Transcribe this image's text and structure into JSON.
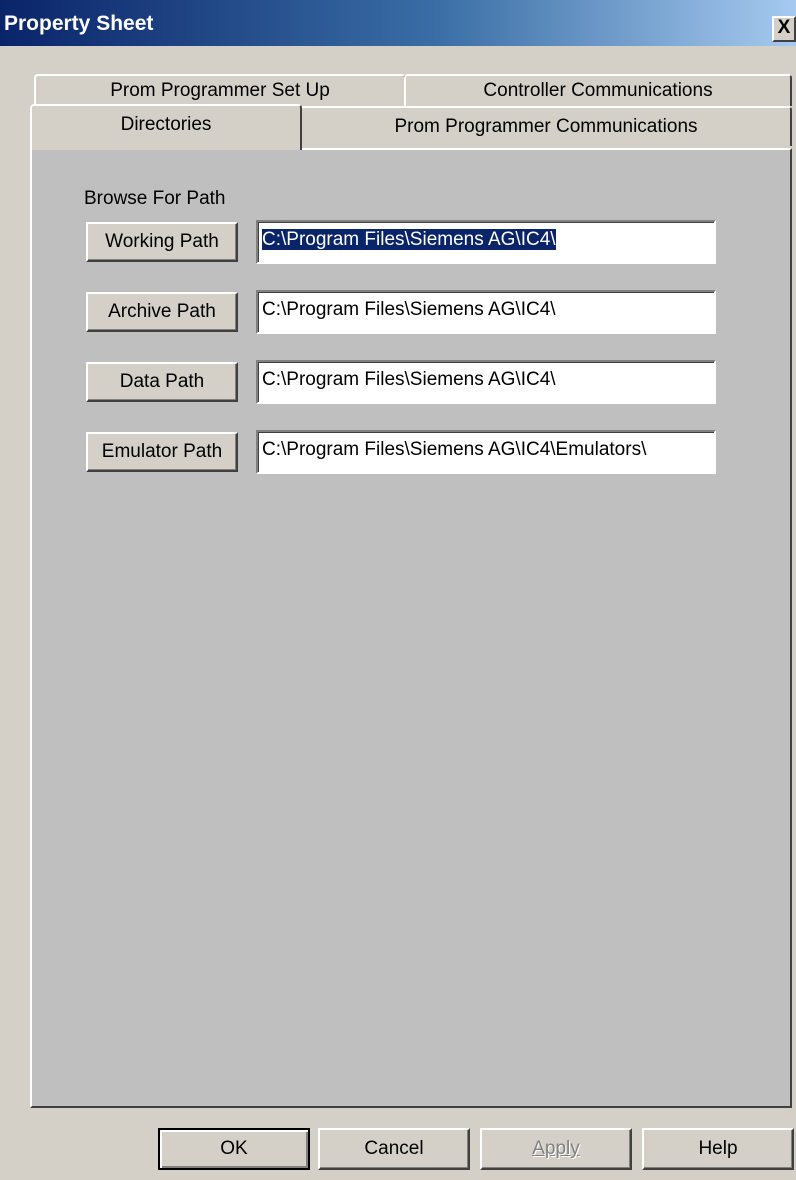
{
  "window": {
    "title": "Property Sheet",
    "close_label": "X"
  },
  "tabs": {
    "row1": [
      {
        "label": "Prom Programmer Set Up"
      },
      {
        "label": "Controller Communications"
      }
    ],
    "row2": [
      {
        "label": "Directories",
        "active": true
      },
      {
        "label": "Prom Programmer Communications"
      }
    ]
  },
  "directories": {
    "group_label": "Browse For Path",
    "paths": [
      {
        "button": "Working Path",
        "value": "C:\\Program Files\\Siemens AG\\IC4\\",
        "selected": true
      },
      {
        "button": "Archive Path",
        "value": "C:\\Program Files\\Siemens AG\\IC4\\"
      },
      {
        "button": "Data Path",
        "value": "C:\\Program Files\\Siemens AG\\IC4\\"
      },
      {
        "button": "Emulator Path",
        "value": "C:\\Program Files\\Siemens AG\\IC4\\Emulators\\"
      }
    ]
  },
  "footer": {
    "ok": "OK",
    "cancel": "Cancel",
    "apply": "Apply",
    "help": "Help"
  },
  "colors": {
    "title_start": "#0a246a",
    "title_end": "#a6caf0",
    "face": "#d4d0c8",
    "panel": "#bfbfbf",
    "selection": "#0a246a"
  }
}
